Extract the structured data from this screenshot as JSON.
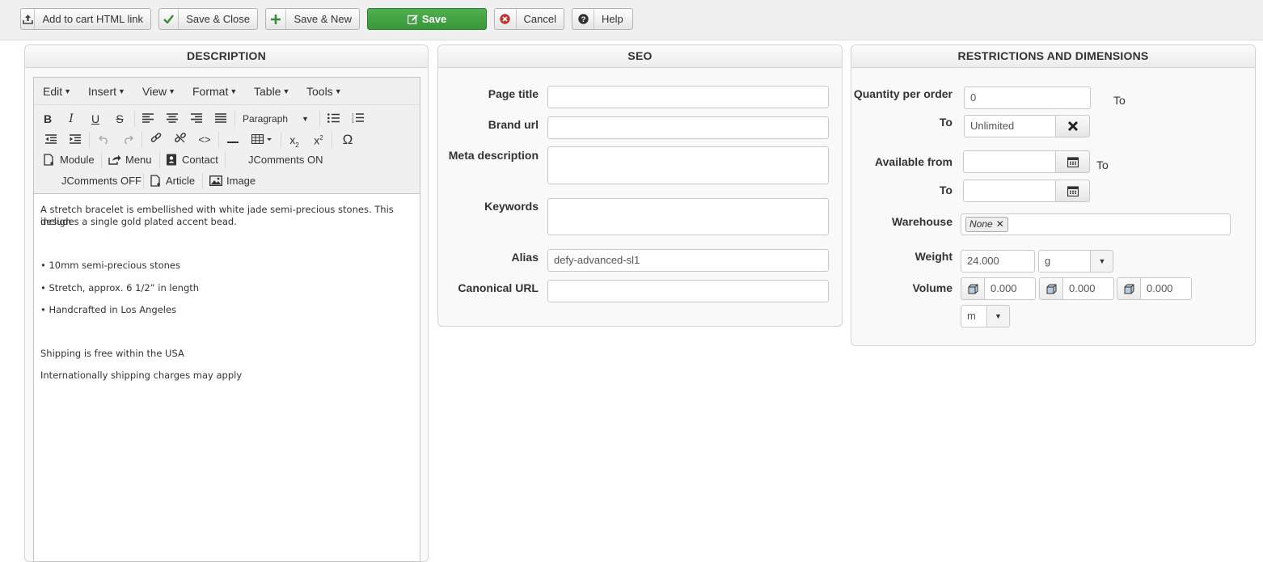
{
  "toolbar": {
    "add_to_cart": "Add to cart HTML link",
    "save_close": "Save & Close",
    "save_new": "Save & New",
    "save": "Save",
    "cancel": "Cancel",
    "help": "Help"
  },
  "description": {
    "title": "DESCRIPTION",
    "menu": [
      "Edit",
      "Insert",
      "View",
      "Format",
      "Table",
      "Tools"
    ],
    "format_select": "Paragraph",
    "plugins": {
      "module": "Module",
      "menu": "Menu",
      "contact": "Contact",
      "jcomments_on": "JComments ON",
      "jcomments_off": "JComments OFF",
      "article": "Article",
      "image": "Image"
    },
    "content": {
      "p1": "A stretch bracelet is embellished with white jade semi-precious stones. This design",
      "p1b": "includes a single gold plated accent bead.",
      "li1": "• 10mm semi-precious stones",
      "li2": "• Stretch, approx. 6 1/2” in length",
      "li3": "• Handcrafted in Los Angeles",
      "p2": "Shipping is free within the USA",
      "p3": "Internationally shipping charges may apply"
    }
  },
  "seo": {
    "title": "SEO",
    "page_title_label": "Page title",
    "brand_url_label": "Brand url",
    "meta_description_label": "Meta description",
    "keywords_label": "Keywords",
    "alias_label": "Alias",
    "alias_value": "defy-advanced-sl1",
    "canonical_label": "Canonical URL"
  },
  "restrictions": {
    "title": "RESTRICTIONS AND DIMENSIONS",
    "qty_label": "Quantity per order",
    "qty_value": "0",
    "to_label": "To",
    "qty_to_value": "Unlimited",
    "available_label": "Available from",
    "warehouse_label": "Warehouse",
    "warehouse_chip": "None",
    "weight_label": "Weight",
    "weight_value": "24.000",
    "weight_unit": "g",
    "volume_label": "Volume",
    "volume_x": "0.000",
    "volume_y": "0.000",
    "volume_z": "0.000",
    "volume_unit": "m"
  },
  "colors": {
    "save_green": "#3f9f3f",
    "cancel_red": "#c0392b"
  }
}
